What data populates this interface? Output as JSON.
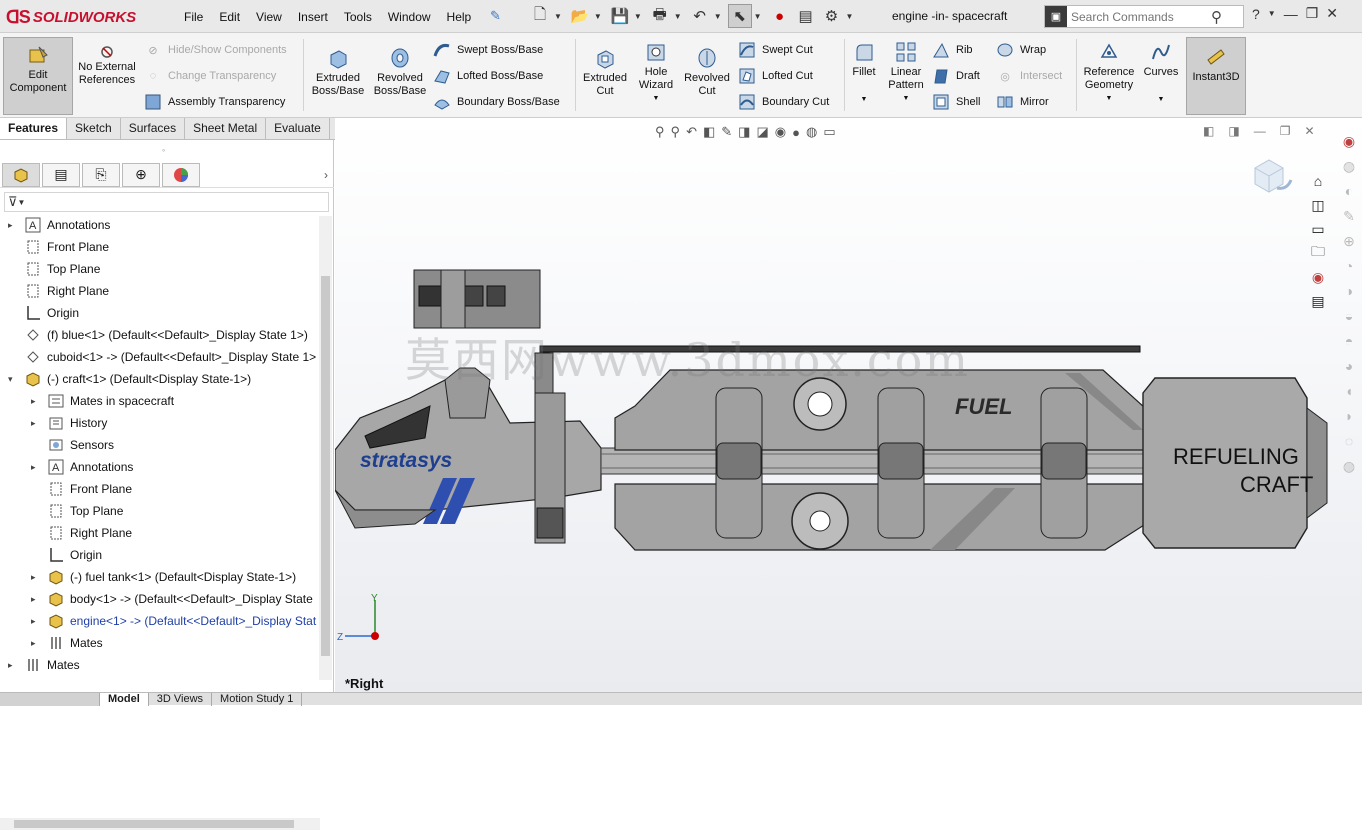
{
  "app": {
    "brand": "SOLIDWORKS",
    "brand_prefix": "3S"
  },
  "menu": [
    "File",
    "Edit",
    "View",
    "Insert",
    "Tools",
    "Window",
    "Help"
  ],
  "document_title": "engine -in- spacecraft",
  "search": {
    "placeholder": "Search Commands"
  },
  "ribbon": {
    "edit_component": "Edit Component",
    "no_external_references": "No External References",
    "hide_show_components": "Hide/Show Components",
    "change_transparency": "Change Transparency",
    "assembly_transparency": "Assembly Transparency",
    "extruded_boss": "Extruded Boss/Base",
    "revolved_boss": "Revolved Boss/Base",
    "swept_boss": "Swept Boss/Base",
    "lofted_boss": "Lofted Boss/Base",
    "boundary_boss": "Boundary Boss/Base",
    "extruded_cut": "Extruded Cut",
    "hole_wizard": "Hole Wizard",
    "revolved_cut": "Revolved Cut",
    "swept_cut": "Swept Cut",
    "lofted_cut": "Lofted Cut",
    "boundary_cut": "Boundary Cut",
    "fillet": "Fillet",
    "linear_pattern": "Linear Pattern",
    "rib": "Rib",
    "draft": "Draft",
    "shell": "Shell",
    "wrap": "Wrap",
    "intersect": "Intersect",
    "mirror": "Mirror",
    "reference_geometry": "Reference Geometry",
    "curves": "Curves",
    "instant3d": "Instant3D"
  },
  "tabs": [
    "Features",
    "Sketch",
    "Surfaces",
    "Sheet Metal",
    "Evaluate"
  ],
  "tree": [
    {
      "label": "Annotations",
      "indent": 0,
      "expand": "▸"
    },
    {
      "label": "Front Plane",
      "indent": 0,
      "expand": ""
    },
    {
      "label": "Top Plane",
      "indent": 0,
      "expand": ""
    },
    {
      "label": "Right Plane",
      "indent": 0,
      "expand": ""
    },
    {
      "label": "Origin",
      "indent": 0,
      "expand": ""
    },
    {
      "label": "(f) blue<1> (Default<<Default>_Display State 1>)",
      "indent": 0,
      "expand": ""
    },
    {
      "label": "cuboid<1> -> (Default<<Default>_Display State 1>",
      "indent": 0,
      "expand": ""
    },
    {
      "label": "(-) craft<1> (Default<Display State-1>)",
      "indent": 0,
      "expand": "▾"
    },
    {
      "label": "Mates in spacecraft",
      "indent": 1,
      "expand": "▸"
    },
    {
      "label": "History",
      "indent": 1,
      "expand": "▸"
    },
    {
      "label": "Sensors",
      "indent": 1,
      "expand": ""
    },
    {
      "label": "Annotations",
      "indent": 1,
      "expand": "▸"
    },
    {
      "label": "Front Plane",
      "indent": 1,
      "expand": ""
    },
    {
      "label": "Top Plane",
      "indent": 1,
      "expand": ""
    },
    {
      "label": "Right Plane",
      "indent": 1,
      "expand": ""
    },
    {
      "label": "Origin",
      "indent": 1,
      "expand": ""
    },
    {
      "label": "(-) fuel tank<1> (Default<Display State-1>)",
      "indent": 1,
      "expand": "▸"
    },
    {
      "label": "body<1> -> (Default<<Default>_Display State",
      "indent": 1,
      "expand": "▸"
    },
    {
      "label": "engine<1> -> (Default<<Default>_Display Stat",
      "indent": 1,
      "expand": "▸"
    },
    {
      "label": "Mates",
      "indent": 1,
      "expand": "▸"
    },
    {
      "label": "Mates",
      "indent": 0,
      "expand": "▸"
    }
  ],
  "viewport": {
    "view_name": "*Right",
    "model_text": {
      "brand": "stratasys",
      "fuel": "FUEL",
      "refuel_1": "REFUELING",
      "refuel_2": "CRAFT"
    },
    "watermark": "莫西网www.3dmox.com",
    "axis": {
      "y": "Y",
      "z": "Z"
    }
  },
  "bottom_tabs": [
    "Model",
    "3D Views",
    "Motion Study 1"
  ],
  "colors": {
    "brand_red": "#c8102e",
    "accent_blue": "#2f4fb0",
    "link_blue": "#1f3fa8"
  }
}
